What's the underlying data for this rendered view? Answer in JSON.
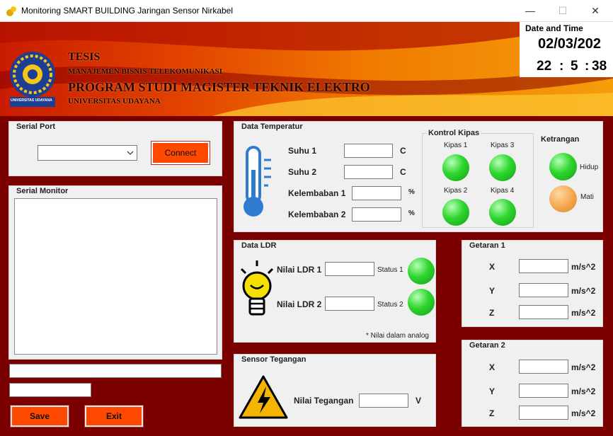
{
  "window": {
    "title": "Monitoring SMART BUILDING Jaringan Sensor Nirkabel",
    "minimize": "—",
    "maximize": "☐",
    "close": "✕"
  },
  "banner": {
    "line1": "TESIS",
    "line2": "MANAJEMEN BISNIS TELEKOMUNIKASI",
    "line3": "PROGRAM STUDI MAGISTER TEKNIK ELEKTRO",
    "line4": "UNIVERSITAS UDAYANA",
    "logo_caption": "UNIVERSITAS UDAYANA"
  },
  "datetime": {
    "label": "Date and Time",
    "date": "02/03/202",
    "hour": "22",
    "sep1": ":",
    "minute": "5",
    "sep2": ":",
    "second": "38"
  },
  "serial_port": {
    "title": "Serial Port",
    "select_value": "",
    "connect_label": "Connect"
  },
  "serial_monitor": {
    "title": "Serial Monitor",
    "text": "",
    "input1": "",
    "input2": ""
  },
  "buttons": {
    "save": "Save",
    "exit": "Exit"
  },
  "temperatur": {
    "title": "Data Temperatur",
    "rows": [
      {
        "label": "Suhu 1",
        "value": "",
        "unit": "C"
      },
      {
        "label": "Suhu 2",
        "value": "",
        "unit": "C"
      },
      {
        "label": "Kelembaban 1",
        "value": "",
        "unit": "%"
      },
      {
        "label": "Kelembaban 2",
        "value": "",
        "unit": "%"
      }
    ],
    "kipas_title": "Kontrol Kipas",
    "kipas": [
      "Kipas 1",
      "Kipas 3",
      "Kipas 2",
      "Kipas 4"
    ],
    "ketrangan_title": "Ketrangan",
    "hidup": "Hidup",
    "mati": "Mati"
  },
  "ldr": {
    "title": "Data LDR",
    "label1": "Nilai LDR 1",
    "value1": "",
    "status1": "Status 1",
    "label2": "Nilai LDR 2",
    "value2": "",
    "status2": "Status 2",
    "note": "* Nilai dalam analog"
  },
  "tegangan": {
    "title": "Sensor Tegangan",
    "label": "Nilai Tegangan",
    "value": "",
    "unit": "V"
  },
  "getaran1": {
    "title": "Getaran 1",
    "axes": [
      "X",
      "Y",
      "Z"
    ],
    "unit": "m/s^2"
  },
  "getaran2": {
    "title": "Getaran 2",
    "axes": [
      "X",
      "Y",
      "Z"
    ],
    "unit": "m/s^2"
  },
  "colors": {
    "background": "#7a0000",
    "button": "#ff4800",
    "led_on": "#2fd62f",
    "led_off": "#f4a54c"
  }
}
